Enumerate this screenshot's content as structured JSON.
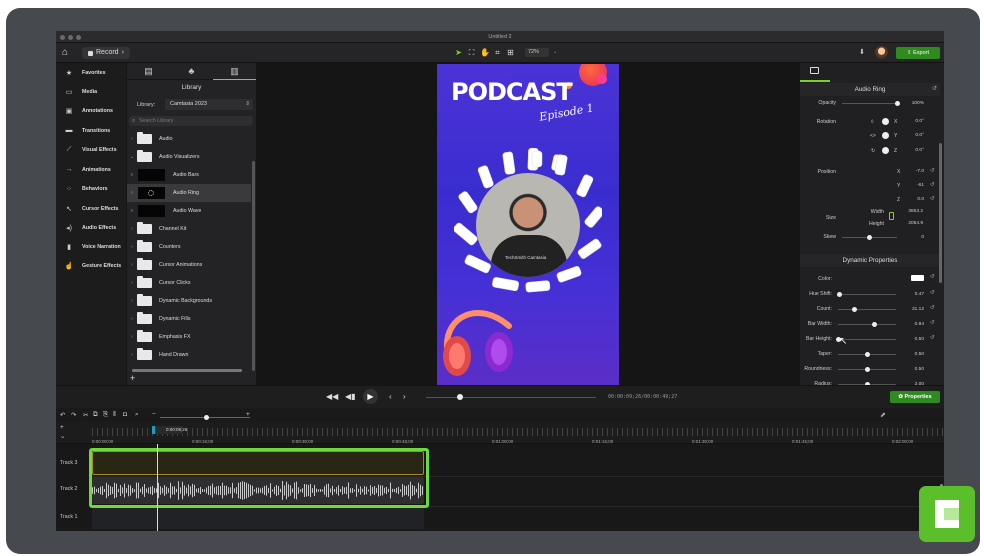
{
  "window": {
    "title": "Untitled 2"
  },
  "toolbar": {
    "record_label": "Record",
    "zoom_value": "72%",
    "export_label": "Export"
  },
  "left_nav": {
    "items": [
      {
        "label": "Favorites",
        "icon": "star-icon"
      },
      {
        "label": "Media",
        "icon": "media-icon"
      },
      {
        "label": "Annotations",
        "icon": "annotations-icon"
      },
      {
        "label": "Transitions",
        "icon": "transitions-icon"
      },
      {
        "label": "Visual Effects",
        "icon": "visual-effects-icon"
      },
      {
        "label": "Animations",
        "icon": "animations-icon"
      },
      {
        "label": "Behaviors",
        "icon": "behaviors-icon"
      },
      {
        "label": "Cursor Effects",
        "icon": "cursor-effects-icon"
      },
      {
        "label": "Audio Effects",
        "icon": "audio-effects-icon"
      },
      {
        "label": "Voice Narration",
        "icon": "microphone-icon"
      },
      {
        "label": "Gesture Effects",
        "icon": "gesture-icon"
      }
    ]
  },
  "library": {
    "title": "Library",
    "library_label": "Library:",
    "library_value": "Camtasia 2023",
    "search_placeholder": "Search Library",
    "items": [
      {
        "label": "Audio",
        "type": "folder"
      },
      {
        "label": "Audio Visualizers",
        "type": "folder",
        "expanded": true
      },
      {
        "label": "Audio Bars",
        "type": "asset"
      },
      {
        "label": "Audio Ring",
        "type": "asset",
        "selected": true
      },
      {
        "label": "Audio Wave",
        "type": "asset"
      },
      {
        "label": "Channel Kit",
        "type": "folder"
      },
      {
        "label": "Counters",
        "type": "folder"
      },
      {
        "label": "Cursor Animations",
        "type": "folder"
      },
      {
        "label": "Cursor Clicks",
        "type": "folder"
      },
      {
        "label": "Dynamic Backgrounds",
        "type": "folder"
      },
      {
        "label": "Dynamic Fills",
        "type": "folder"
      },
      {
        "label": "Emphasis FX",
        "type": "folder"
      },
      {
        "label": "Hand Drawn",
        "type": "folder"
      }
    ]
  },
  "canvas": {
    "title_text": "PODCAST",
    "subtitle_text": "Episode 1",
    "shirt_text": "TechSmith Camtasia"
  },
  "properties": {
    "section_title": "Audio Ring",
    "opacity": {
      "label": "Opacity",
      "value": "100%",
      "level": 1.0
    },
    "rotation": {
      "label": "Rotation",
      "x": "0.0°",
      "y": "0.0°",
      "z": "0.0°"
    },
    "position": {
      "label": "Position",
      "x": "-7.0",
      "y": "-61",
      "z": "0.0"
    },
    "size": {
      "label": "Size",
      "width_label": "Width",
      "width": "3653.2",
      "height_label": "Height",
      "height": "2054.9"
    },
    "skew": {
      "label": "Skew",
      "value": "0",
      "level": 0.5
    },
    "dynamic_title": "Dynamic Properties",
    "dynamic": [
      {
        "label": "Color:",
        "value": "",
        "level": null
      },
      {
        "label": "Hue Shift:",
        "value": "0.47",
        "level": 0.03
      },
      {
        "label": "Count:",
        "value": "31.12",
        "level": 0.28
      },
      {
        "label": "Bar Width:",
        "value": "0.94",
        "level": 0.63
      },
      {
        "label": "Bar Height:",
        "value": "0.50",
        "level": 0.0
      },
      {
        "label": "Taper:",
        "value": "0.50",
        "level": 0.5
      },
      {
        "label": "Roundness:",
        "value": "0.50",
        "level": 0.5
      },
      {
        "label": "Radius:",
        "value": "2.00",
        "level": 0.5
      }
    ],
    "properties_button": "Properties"
  },
  "playback": {
    "timecode_current": "00:00:09;26",
    "timecode_total": "00:00:49;27",
    "progress": 0.2
  },
  "timeline": {
    "playhead_label": "0:00:09;26",
    "ticks": [
      "0:00:00;00",
      "0:00:15;00",
      "0:00:30;00",
      "0:00:45;00",
      "0:01:00;00",
      "0:01:15;00",
      "0:01:30;00",
      "0:01:45;00",
      "0:02:00;00"
    ],
    "tracks": [
      "Track 3",
      "Track 2",
      "Track 1"
    ]
  }
}
